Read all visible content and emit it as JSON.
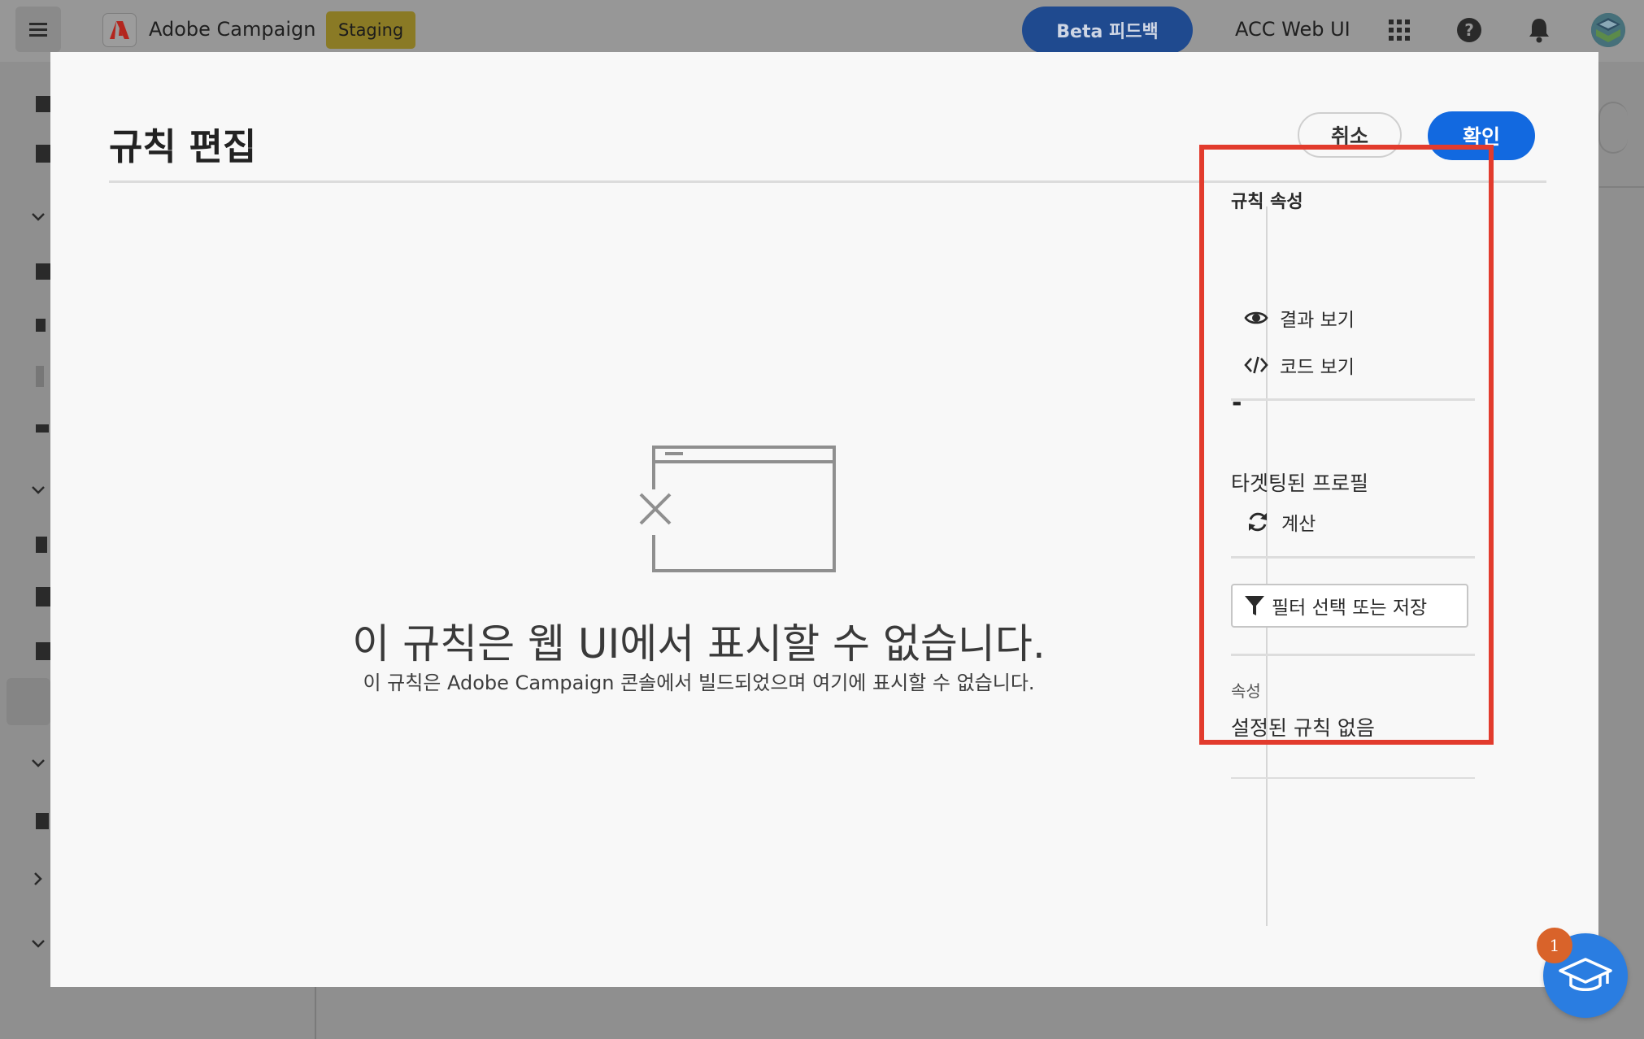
{
  "header": {
    "app_title": "Adobe Campaign",
    "env_badge": "Staging",
    "beta_feedback": "Beta 피드백",
    "acc_web_ui": "ACC Web UI"
  },
  "modal": {
    "title": "규칙 편집",
    "cancel_label": "취소",
    "confirm_label": "확인",
    "empty_state": {
      "title": "이 규칙은 웹 UI에서 표시할 수 없습니다.",
      "description": "이 규칙은 Adobe Campaign 콘솔에서 빌드되었으며 여기에 표시할 수 없습니다."
    },
    "right_panel": {
      "section_title": "규칙 속성",
      "view_results": "결과 보기",
      "view_code": "코드 보기",
      "targeted_count": "-",
      "targeted_profiles_label": "타겟팅된 프로필",
      "calculate": "계산",
      "filter_button": "필터 선택 또는 저장",
      "properties_label": "속성",
      "properties_value": "설정된 규칙 없음"
    }
  },
  "learn_badge_count": "1",
  "colors": {
    "primary": "#1269e0",
    "highlight": "#e23b2d",
    "badge": "#d9632a",
    "fab": "#2a7de1"
  }
}
